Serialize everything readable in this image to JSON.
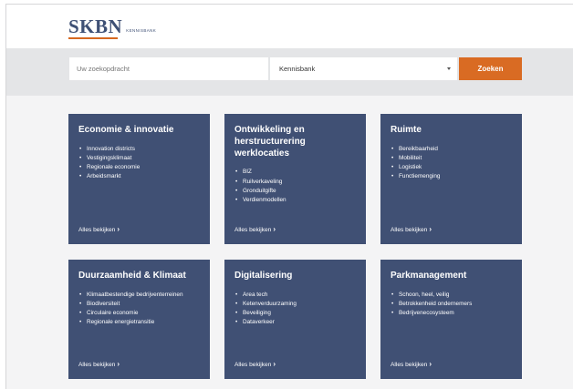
{
  "header": {
    "logo_text": "SKBN",
    "logo_subtitle": "KENNISBANK"
  },
  "search": {
    "placeholder": "Uw zoekopdracht",
    "select_value": "Kennisbank",
    "button_label": "Zoeken"
  },
  "cards": [
    {
      "title": "Economie & innovatie",
      "items": [
        "Innovation districts",
        "Vestigingsklimaat",
        "Regionale economie",
        "Arbeidsmarkt"
      ],
      "link": "Alles bekijken"
    },
    {
      "title": "Ontwikkeling en herstructurering werklocaties",
      "items": [
        "BIZ",
        "Ruilverkaveling",
        "Gronduitgifte",
        "Verdienmodellen"
      ],
      "link": "Alles bekijken"
    },
    {
      "title": "Ruimte",
      "items": [
        "Bereikbaarheid",
        "Mobiliteit",
        "Logistiek",
        "Functiemenging"
      ],
      "link": "Alles bekijken"
    },
    {
      "title": "Duurzaamheid & Klimaat",
      "items": [
        "Klimaatbestendige bedrijventerreinen",
        "Biodiversiteit",
        "Circulaire economie",
        "Regionale energietransitie"
      ],
      "link": "Alles bekijken"
    },
    {
      "title": "Digitalisering",
      "items": [
        "Area tech",
        "Ketenverduurzaming",
        "Beveiliging",
        "Dataverkeer"
      ],
      "link": "Alles bekijken"
    },
    {
      "title": "Parkmanagement",
      "items": [
        "Schoon, heel, veilig",
        "Betrokkenheid ondernemers",
        "Bedrijvenecosysteem"
      ],
      "link": "Alles bekijken"
    }
  ],
  "colors": {
    "brand_blue": "#405074",
    "accent_orange": "#d96b23",
    "logo_blue": "#3e5075"
  },
  "icons": {
    "select_arrow": "chevron-down-icon",
    "link_arrow": "chevron-right-icon"
  }
}
